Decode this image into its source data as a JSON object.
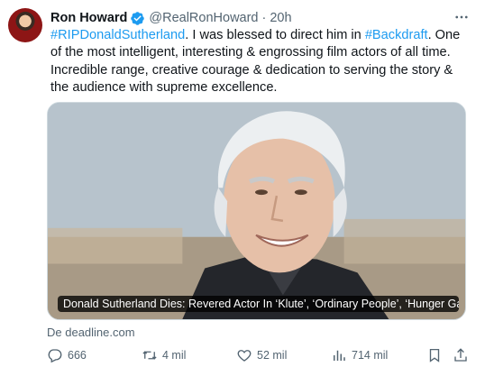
{
  "tweet": {
    "author_name": "Ron Howard",
    "handle": "@RealRonHoward",
    "separator": "·",
    "time": "20h",
    "text_parts": {
      "tag1": "#RIPDonaldSutherland",
      "t1": ". I was blessed to direct him in ",
      "tag2": "#Backdraft",
      "t2": ". One of the most intelligent, interesting & engrossing film actors of all time. Incredible range, creative courage  & dedication to serving the story & the audience with supreme excellence."
    },
    "card": {
      "title": "Donald Sutherland Dies: Revered Actor In ‘Klute’, ‘Ordinary People’, ‘Hunger Ga…",
      "source": "De deadline.com"
    },
    "actions": {
      "replies": "666",
      "retweets": "4 mil",
      "likes": "52 mil",
      "views": "714 mil"
    },
    "colors": {
      "link": "#1d9bf0",
      "muted": "#536471",
      "verified": "#1d9bf0"
    },
    "icons": [
      "verified-badge-icon",
      "more-icon",
      "reply-icon",
      "retweet-icon",
      "like-icon",
      "views-icon",
      "bookmark-icon",
      "share-icon"
    ]
  }
}
